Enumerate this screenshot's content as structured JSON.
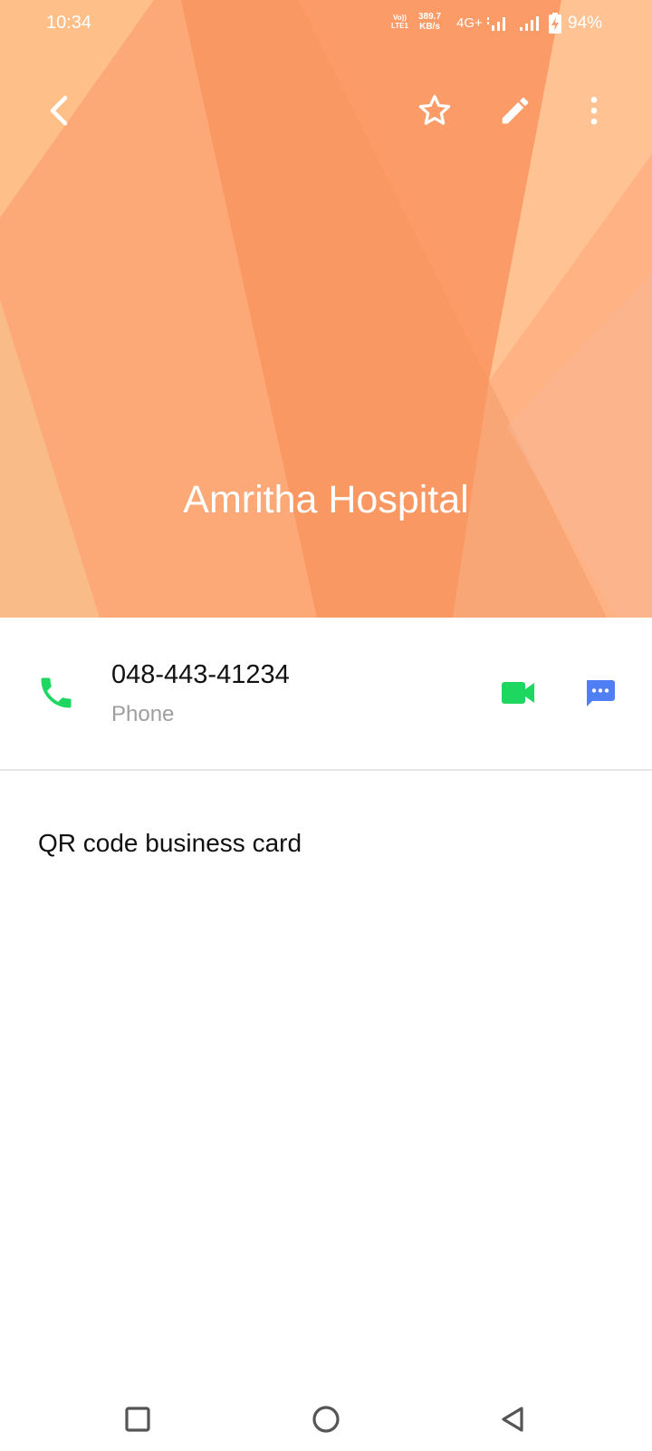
{
  "status_bar": {
    "time": "10:34",
    "volte_top": "Vo))",
    "volte_bottom": "LTE1",
    "speed_value": "389.7",
    "speed_unit": "KB/s",
    "network": "4G+",
    "battery_percent": "94%"
  },
  "toolbar": {
    "back_icon": "chevron-left-icon",
    "favorite_icon": "star-outline-icon",
    "edit_icon": "pencil-icon",
    "more_icon": "more-vertical-icon"
  },
  "contact": {
    "name": "Amritha Hospital",
    "phone_number": "048-443-41234",
    "phone_type": "Phone"
  },
  "actions": {
    "video_call_icon": "video-call-icon",
    "message_icon": "message-icon"
  },
  "menu": {
    "qr_label": "QR code business card"
  },
  "colors": {
    "header_orange": "#fb9e6b",
    "call_green": "#1ed760",
    "message_blue": "#4f7ef5"
  }
}
